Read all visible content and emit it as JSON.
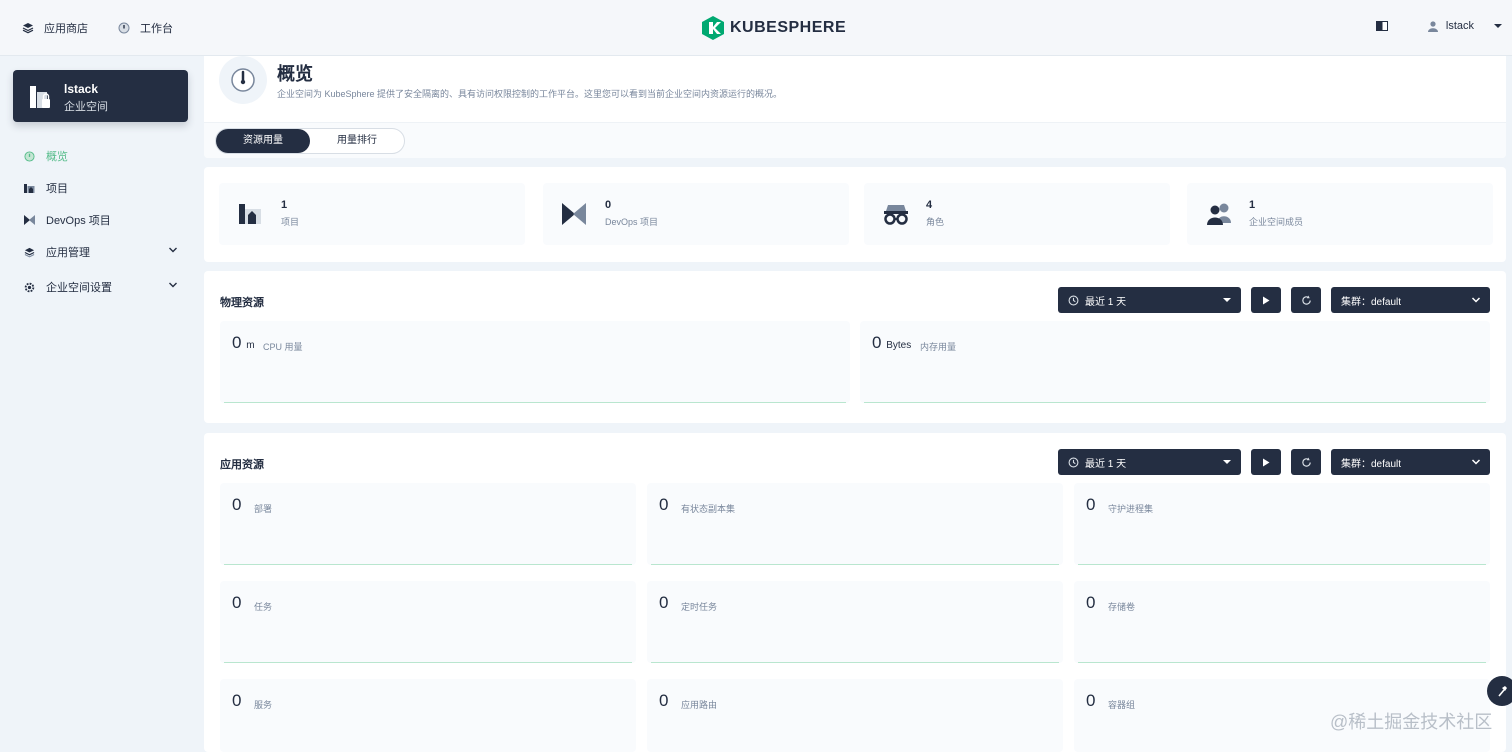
{
  "topbar": {
    "app_store": "应用商店",
    "workbench": "工作台",
    "logo_text": "KUBESPHERE",
    "user": "lstack"
  },
  "workspace": {
    "name": "lstack",
    "type": "企业空间"
  },
  "sidebar": {
    "items": [
      {
        "label": "概览",
        "icon": "overview-icon",
        "active": true
      },
      {
        "label": "项目",
        "icon": "project-icon"
      },
      {
        "label": "DevOps 项目",
        "icon": "devops-icon"
      },
      {
        "label": "应用管理",
        "icon": "app-manage-icon",
        "expandable": true
      },
      {
        "label": "企业空间设置",
        "icon": "gear-icon",
        "expandable": true
      }
    ]
  },
  "overview": {
    "title": "概览",
    "description": "企业空间为 KubeSphere 提供了安全隔离的、具有访问权限控制的工作平台。这里您可以看到当前企业空间内资源运行的概况。",
    "tabs": [
      "资源用量",
      "用量排行"
    ],
    "active_tab": 0
  },
  "stats": [
    {
      "value": "1",
      "label": "项目",
      "icon": "project-icon"
    },
    {
      "value": "0",
      "label": "DevOps 项目",
      "icon": "devops-icon"
    },
    {
      "value": "4",
      "label": "角色",
      "icon": "role-icon"
    },
    {
      "value": "1",
      "label": "企业空间成员",
      "icon": "members-icon"
    }
  ],
  "physical": {
    "title": "物理资源",
    "time_range": "最近 1 天",
    "cluster": "集群：default",
    "metrics": [
      {
        "value": "0",
        "unit": "m",
        "label": "CPU 用量"
      },
      {
        "value": "0",
        "unit": "Bytes",
        "label": "内存用量"
      }
    ]
  },
  "app_resources": {
    "title": "应用资源",
    "time_range": "最近 1 天",
    "cluster": "集群：default",
    "metrics": [
      {
        "value": "0",
        "label": "部署"
      },
      {
        "value": "0",
        "label": "有状态副本集"
      },
      {
        "value": "0",
        "label": "守护进程集"
      },
      {
        "value": "0",
        "label": "任务"
      },
      {
        "value": "0",
        "label": "定时任务"
      },
      {
        "value": "0",
        "label": "存储卷"
      },
      {
        "value": "0",
        "label": "服务"
      },
      {
        "value": "0",
        "label": "应用路由"
      },
      {
        "value": "0",
        "label": "容器组"
      }
    ]
  },
  "watermark": "@稀土掘金技术社区",
  "colors": {
    "dark": "#242e42",
    "accent": "#55bc8a",
    "bg": "#eff4f9"
  }
}
